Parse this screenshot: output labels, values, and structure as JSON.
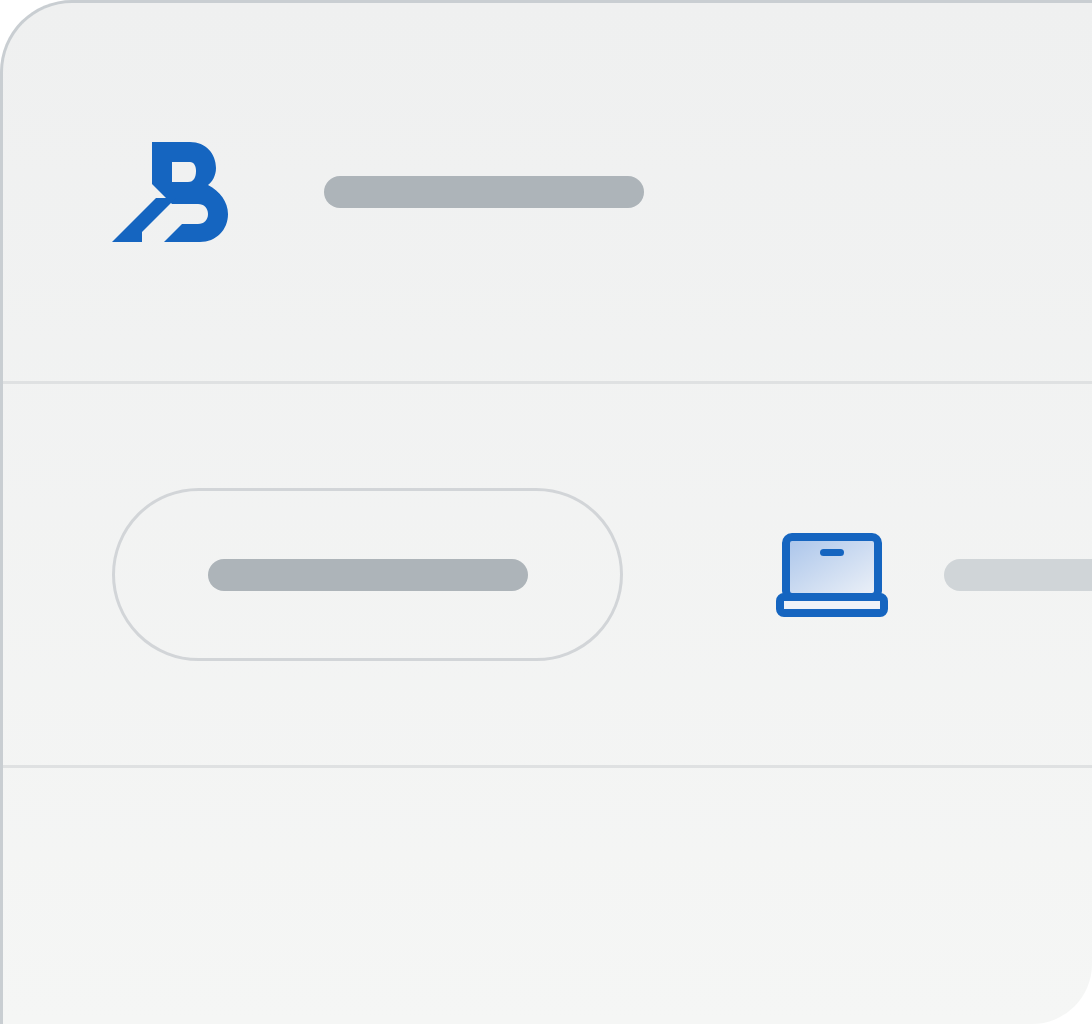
{
  "header": {
    "items": [
      {
        "kind": "logo"
      },
      {
        "kind": "text-placeholder"
      }
    ]
  },
  "rows": [
    {
      "items": [
        {
          "kind": "button-placeholder"
        },
        {
          "kind": "laptop"
        },
        {
          "kind": "text-placeholder"
        }
      ]
    }
  ]
}
